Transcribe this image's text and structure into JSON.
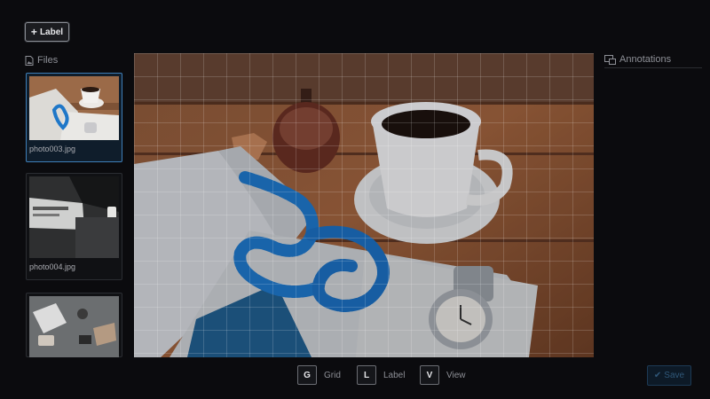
{
  "toolbar": {
    "label_button": "Label",
    "label_icon": "plus-icon"
  },
  "files": {
    "header": "Files",
    "header_icon": "file-image-icon",
    "items": [
      {
        "name": "photo003.jpg",
        "selected": true
      },
      {
        "name": "photo004.jpg",
        "selected": false
      },
      {
        "name": "",
        "selected": false
      }
    ]
  },
  "annotations": {
    "header": "Annotations",
    "header_icon": "annotations-icon"
  },
  "canvas": {
    "grid_visible": true
  },
  "shortcuts": [
    {
      "key": "G",
      "label": "Grid"
    },
    {
      "key": "L",
      "label": "Label"
    },
    {
      "key": "V",
      "label": "View"
    }
  ],
  "save": {
    "label": "Save",
    "icon": "check-icon",
    "enabled": false
  },
  "colors": {
    "accent": "#3f7fb8",
    "background": "#0b0b0e"
  }
}
